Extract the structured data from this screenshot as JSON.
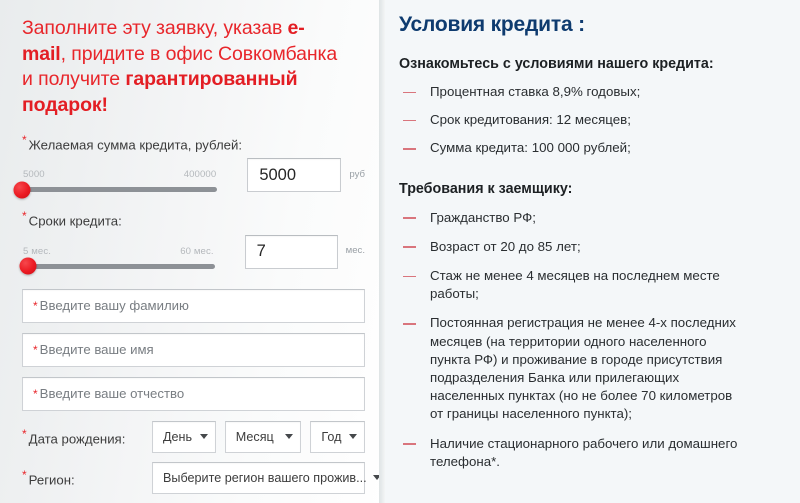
{
  "colors": {
    "accent_red": "#e8262b",
    "heading_navy": "#0e3b6f",
    "bullet_dash": "#d9757d",
    "slider_track": "#8d9196",
    "left_bg": "#eef0f1",
    "right_bg": "#f4f7f9"
  },
  "left": {
    "headline": {
      "part1": "Заполните эту заявку, указав ",
      "bold1": "e-mail",
      "part2": ", придите в офис Совкомбанка и получите ",
      "bold2": "гарантированный подарок!"
    },
    "amount": {
      "label": "Желаемая сумма кредита, рублей:",
      "required_mark": "*",
      "min": "5000",
      "max": "400000",
      "value": "5000",
      "unit": "руб",
      "knob_percent": 0
    },
    "term": {
      "label": "Сроки кредита:",
      "required_mark": "*",
      "min": "5 мес.",
      "max": "60 мес.",
      "value": "7",
      "unit": "мес.",
      "knob_percent": 3
    },
    "inputs": [
      {
        "required_mark": "*",
        "placeholder": "Введите вашу фамилию",
        "value": ""
      },
      {
        "required_mark": "*",
        "placeholder": "Введите ваше имя",
        "value": ""
      },
      {
        "required_mark": "*",
        "placeholder": "Введите ваше отчество",
        "value": ""
      }
    ],
    "birth": {
      "label": "Дата рождения:",
      "required_mark": "*",
      "day": "День",
      "month": "Месяц",
      "year": "Год"
    },
    "region": {
      "label": "Регион:",
      "required_mark": "*",
      "value": "Выберите регион вашего прожив..."
    }
  },
  "right": {
    "title": "Условия кредита :",
    "subtitle_1": "Ознакомьтесь с условиями нашего кредита:",
    "conditions": [
      "Процентная ставка 8,9% годовых;",
      "Срок кредитования: 12 месяцев;",
      "Сумма кредита: 100 000 рублей;"
    ],
    "subtitle_2": "Требования к заемщику:",
    "requirements": [
      "Гражданство РФ;",
      "Возраст от 20 до 85 лет;",
      "Стаж не менее 4 месяцев на последнем месте работы;",
      "Постоянная регистрация не менее 4-х последних месяцев (на территории одного населенного пункта РФ) и проживание в городе присутствия подразделения Банка или прилегающих населенных пунктах (но не более 70 километров от границы населенного пункта);",
      "Наличие стационарного рабочего или домашнего телефона*."
    ]
  }
}
